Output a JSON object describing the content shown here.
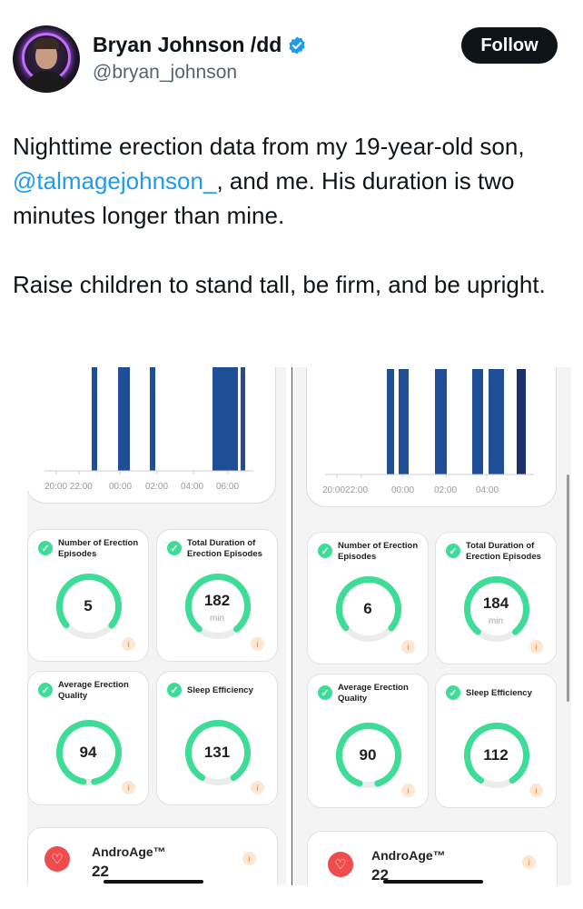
{
  "tweet": {
    "display_name": "Bryan Johnson /dd",
    "handle": "@bryan_johnson",
    "follow_label": "Follow",
    "text_part1": "Nighttime erection data from my 19-year-old son, ",
    "mention": "@talmagejohnson_",
    "text_part2": ", and me. His duration is two minutes longer than mine.",
    "text_paragraph2": "Raise children to stand tall, be firm, and be upright."
  },
  "colors": {
    "ring": "#3ddc97",
    "bar": "#1f4e96",
    "bar_dark": "#1a2f6b",
    "accent_link": "#1d9bf0"
  },
  "panels": [
    {
      "id": "left",
      "chart_ticks": [
        "20:00 22:00",
        "00:00",
        "02:00",
        "04:00",
        "06:00"
      ],
      "tiles": [
        {
          "title": "Number of Erection Episodes",
          "value": "5",
          "unit": "",
          "progress": 0.72
        },
        {
          "title": "Total Duration of Erection Episodes",
          "value": "182",
          "unit": "min",
          "progress": 0.78
        },
        {
          "title": "Average Erection Quality",
          "value": "94",
          "unit": "",
          "progress": 0.94
        },
        {
          "title": "Sleep Efficiency",
          "value": "131",
          "unit": "",
          "progress": 0.82
        }
      ],
      "andro": {
        "title": "AndroAge™",
        "value": "22"
      }
    },
    {
      "id": "right",
      "chart_ticks": [
        "20:0022:00",
        "00:00",
        "02:00",
        "04:00"
      ],
      "tiles": [
        {
          "title": "Number of Erection Episodes",
          "value": "6",
          "unit": "",
          "progress": 0.72
        },
        {
          "title": "Total Duration of Erection Episodes",
          "value": "184",
          "unit": "min",
          "progress": 0.78
        },
        {
          "title": "Average Erection Quality",
          "value": "90",
          "unit": "",
          "progress": 0.9
        },
        {
          "title": "Sleep Efficiency",
          "value": "112",
          "unit": "",
          "progress": 0.82
        }
      ],
      "andro": {
        "title": "AndroAge™",
        "value": "22"
      }
    }
  ]
}
